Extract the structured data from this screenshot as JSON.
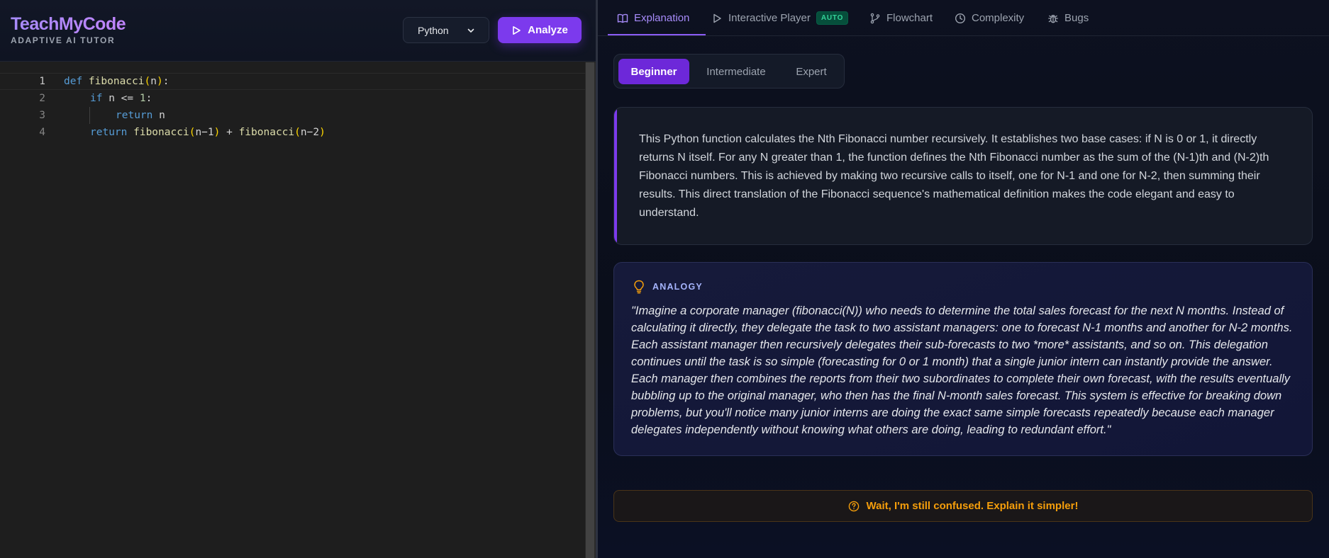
{
  "header": {
    "brand_title": "TeachMyCode",
    "brand_subtitle": "ADAPTIVE AI TUTOR",
    "language_selected": "Python",
    "analyze_label": "Analyze"
  },
  "editor": {
    "lines": [
      {
        "number": "1"
      },
      {
        "number": "2"
      },
      {
        "number": "3"
      },
      {
        "number": "4"
      }
    ],
    "tokens": {
      "l1_def": "def",
      "l1_name": " fibonacci",
      "l1_open": "(",
      "l1_arg": "n",
      "l1_close": ")",
      "l1_colon": ":",
      "l2_if": "if",
      "l2_rest": " n <= ",
      "l2_num": "1",
      "l2_colon": ":",
      "l3_return": "return",
      "l3_rest": " n",
      "l4_return": "return",
      "l4_call1": " fibonacci",
      "l4_open1": "(",
      "l4_arg1": "n−1",
      "l4_close1": ")",
      "l4_plus": " + ",
      "l4_call2": "fibonacci",
      "l4_open2": "(",
      "l4_arg2": "n−2",
      "l4_close2": ")"
    }
  },
  "tabs": [
    {
      "label": "Explanation",
      "icon": "book-open-icon"
    },
    {
      "label": "Interactive Player",
      "icon": "play-icon",
      "badge": "AUTO"
    },
    {
      "label": "Flowchart",
      "icon": "git-branch-icon"
    },
    {
      "label": "Complexity",
      "icon": "clock-icon"
    },
    {
      "label": "Bugs",
      "icon": "bug-icon"
    }
  ],
  "levels": [
    {
      "label": "Beginner",
      "active": true
    },
    {
      "label": "Intermediate",
      "active": false
    },
    {
      "label": "Expert",
      "active": false
    }
  ],
  "explanation": {
    "text": "This Python function calculates the Nth Fibonacci number recursively. It establishes two base cases: if N is 0 or 1, it directly returns N itself. For any N greater than 1, the function defines the Nth Fibonacci number as the sum of the (N-1)th and (N-2)th Fibonacci numbers. This is achieved by making two recursive calls to itself, one for N-1 and one for N-2, then summing their results. This direct translation of the Fibonacci sequence's mathematical definition makes the code elegant and easy to understand."
  },
  "analogy": {
    "label": "ANALOGY",
    "text": "\"Imagine a corporate manager (fibonacci(N)) who needs to determine the total sales forecast for the next N months. Instead of calculating it directly, they delegate the task to two assistant managers: one to forecast N-1 months and another for N-2 months. Each assistant manager then recursively delegates their sub-forecasts to two *more* assistants, and so on. This delegation continues until the task is so simple (forecasting for 0 or 1 month) that a single junior intern can instantly provide the answer. Each manager then combines the reports from their two subordinates to complete their own forecast, with the results eventually bubbling up to the original manager, who then has the final N-month sales forecast. This system is effective for breaking down problems, but you'll notice many junior interns are doing the exact same simple forecasts repeatedly because each manager delegates independently without knowing what others are doing, leading to redundant effort.\""
  },
  "confused_button": {
    "label": "Wait, I'm still confused. Explain it simpler!"
  },
  "colors": {
    "accent": "#7c3aed",
    "warning": "#f59e0b",
    "badge_green": "#34d399"
  }
}
